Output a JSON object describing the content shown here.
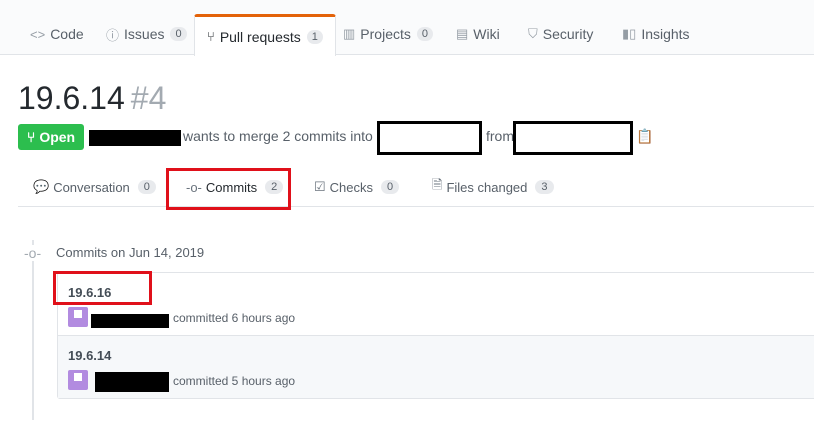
{
  "topnav": {
    "tabs": [
      {
        "label": "Code",
        "icon": "code-icon",
        "count": ""
      },
      {
        "label": "Issues",
        "icon": "issue-icon",
        "count": "0"
      },
      {
        "label": "Pull requests",
        "icon": "pull-request-icon",
        "count": "1"
      },
      {
        "label": "Projects",
        "icon": "project-icon",
        "count": "0"
      },
      {
        "label": "Wiki",
        "icon": "book-icon",
        "count": ""
      },
      {
        "label": "Security",
        "icon": "shield-icon",
        "count": ""
      },
      {
        "label": "Insights",
        "icon": "graph-icon",
        "count": ""
      }
    ],
    "active": "Pull requests"
  },
  "pr": {
    "title": "19.6.14",
    "number": "#4",
    "state": "Open",
    "merge_text": "wants to merge 2 commits into",
    "from_text": "from"
  },
  "subtabs": [
    {
      "label": "Conversation",
      "icon": "comment-icon",
      "count": "0"
    },
    {
      "label": "Commits",
      "icon": "commit-icon",
      "count": "2"
    },
    {
      "label": "Checks",
      "icon": "checklist-icon",
      "count": "0"
    },
    {
      "label": "Files changed",
      "icon": "file-diff-icon",
      "count": "3"
    }
  ],
  "commits": {
    "date_heading": "Commits on Jun 14, 2019",
    "items": [
      {
        "message": "19.6.16",
        "time": "committed 6 hours ago"
      },
      {
        "message": "19.6.14",
        "time": "committed 5 hours ago"
      }
    ]
  },
  "colors": {
    "accent": "#e36209",
    "open_green": "#2cbe4e",
    "highlight_red": "#e0101a"
  }
}
